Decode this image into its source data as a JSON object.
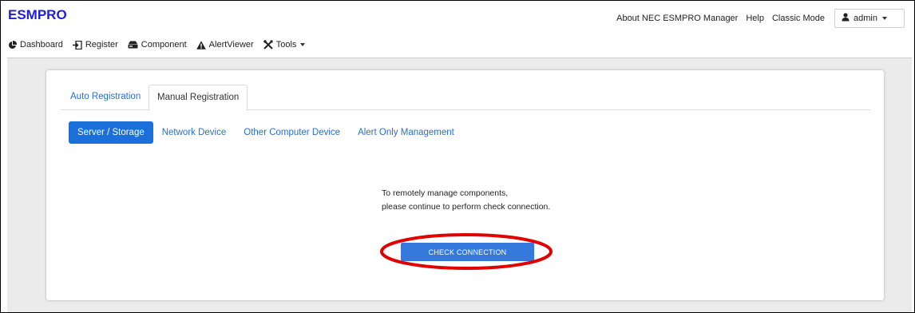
{
  "header": {
    "brand": "ESMPRO",
    "links": {
      "about": "About NEC ESMPRO Manager",
      "help": "Help",
      "classic": "Classic Mode"
    },
    "user": "admin"
  },
  "nav": {
    "dashboard": "Dashboard",
    "register": "Register",
    "component": "Component",
    "alertviewer": "AlertViewer",
    "tools": "Tools"
  },
  "tabs": {
    "auto": "Auto Registration",
    "manual": "Manual Registration",
    "active": "manual"
  },
  "device_types": {
    "server": "Server / Storage",
    "network": "Network Device",
    "other": "Other Computer Device",
    "alert": "Alert Only Management",
    "active": "server"
  },
  "message": {
    "line1": "To remotely manage components,",
    "line2": "please continue to perform check connection."
  },
  "action": {
    "check_connection": "CHECK CONNECTION"
  },
  "colors": {
    "brand": "#1f1fd6",
    "accent": "#1b6fd8",
    "link": "#2b6fc4",
    "highlight": "#e00000"
  },
  "icons": {
    "dashboard": "pie-chart-icon",
    "register": "register-icon",
    "component": "component-icon",
    "alertviewer": "warning-icon",
    "tools": "tools-icon",
    "user": "user-icon"
  }
}
